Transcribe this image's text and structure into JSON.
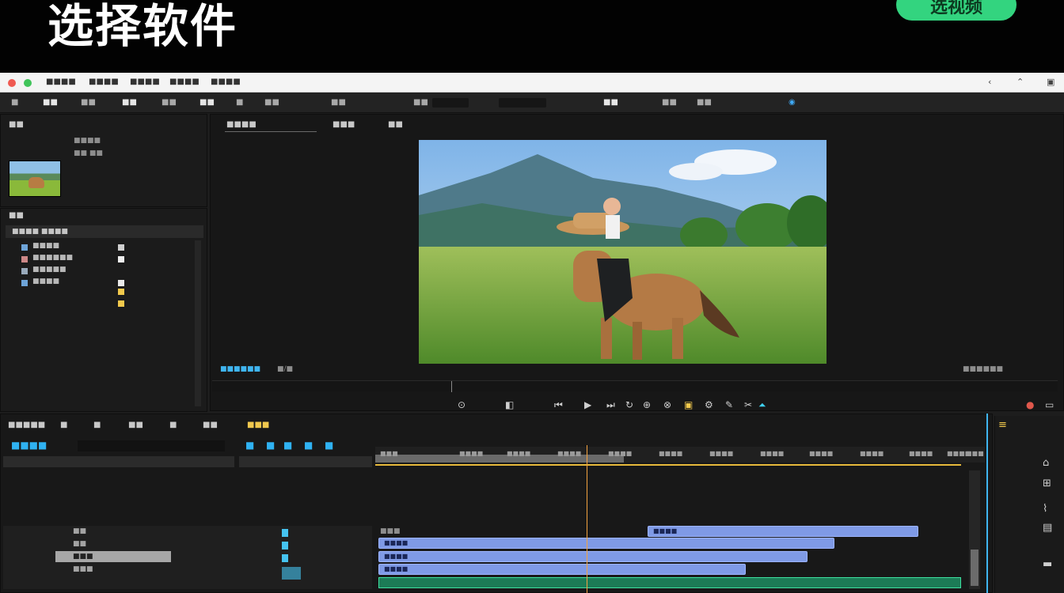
{
  "banner": {
    "title": "选择软件",
    "button_label": "选视频"
  },
  "titlebar": {
    "menus": [
      "■■■■",
      "■■■■",
      "■■■■",
      "■■■■",
      "■■■■"
    ]
  },
  "toolbar": {
    "items": [
      "■",
      "■■",
      "■■",
      "■■",
      "■■",
      "■■",
      "■",
      "■■",
      "■■",
      "■■",
      "■■",
      "■■",
      "■■"
    ]
  },
  "project_panel": {
    "title": "■■",
    "clip_name": "■■■■",
    "clip_meta": "■■ ■■",
    "bin_title": "■■",
    "bin_header": "■■■■ ■■■■",
    "rows": [
      "■■■■",
      "■■■■■■",
      "■■■■■",
      "■■■■"
    ]
  },
  "program_monitor": {
    "tab_1": "■■■■",
    "tab_2": "■■■",
    "tab_3": "■■",
    "timecode_left": "■■■■■■",
    "zoom": "■/■",
    "bottom_right": "■■■■■■"
  },
  "timeline": {
    "tabs": [
      "■■■■■",
      "■",
      "■",
      "■■",
      "■",
      "■■",
      "■■■"
    ],
    "active_tab_index": 6,
    "buttons": [
      "■■■■",
      "■",
      "■",
      "■",
      "■",
      "■"
    ],
    "ruler_labels": [
      "■■■",
      "■■■■",
      "■■■■",
      "■■■■",
      "■■■■",
      "■■■■",
      "■■■■",
      "■■■■",
      "■■■■",
      "■■■■",
      "■■■■",
      "■■■■",
      "■■■"
    ],
    "tracks": [
      "■■",
      "■■",
      "■■■",
      "■■■"
    ],
    "clips": [
      {
        "label": "■■■"
      },
      {
        "label": "■■■■"
      },
      {
        "label": "■■■■"
      },
      {
        "label": "■■■■"
      },
      {
        "label": "■■■■"
      }
    ]
  },
  "colors": {
    "accent_green": "#33d47f",
    "accent_blue": "#2fb2f2",
    "playhead": "#f4a340",
    "clip_blue": "#7f9ae6",
    "audio_green": "#1c7b56"
  }
}
